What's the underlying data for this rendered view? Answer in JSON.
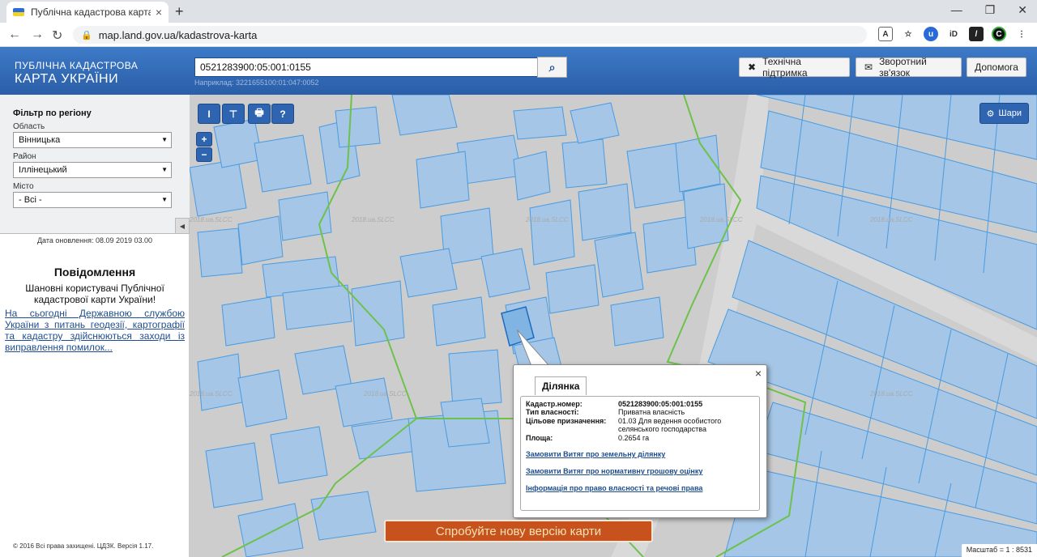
{
  "browser": {
    "tab_title": "Публічна кадастрова карта Укр",
    "url": "map.land.gov.ua/kadastrova-karta",
    "new_tab": "+",
    "tab_close": "×",
    "window_controls": [
      "—",
      "❐",
      "✕"
    ]
  },
  "header": {
    "logo_line1": "ПУБЛІЧНА КАДАСТРОВА",
    "logo_line2": "КАРТА УКРАЇНИ",
    "search_value": "0521283900:05:001:0155",
    "search_example": "Наприклад: 3221655100:01:047:0052",
    "support_label": "Технічна підтримка",
    "feedback_label": "Зворотний зв'язок",
    "help_label": "Допомога"
  },
  "sidebar": {
    "filter_title": "Фільтр по регіону",
    "oblast_label": "Область",
    "oblast_value": "Вінницька",
    "rayon_label": "Район",
    "rayon_value": "Іллінецький",
    "misto_label": "Місто",
    "misto_value": "- Всі -",
    "updated": "Дата оновлення: 08.09 2019 03.00",
    "news_title": "Повідомлення",
    "news_greeting": "Шановні користувачі Публічної кадастрової карти України!",
    "news_text": "На сьогодні Державною службою України з питань геодезії, картографії та кадастру здійснюються заходи із виправлення помилок...",
    "copyright": "© 2016 Всі права захищені. ЦДЗК. Версія 1.17."
  },
  "map": {
    "tool_measure_line": "I",
    "tool_measure_area": "⊤",
    "tool_print": "🖶",
    "tool_identify": "?",
    "zoom_in": "+",
    "zoom_out": "−",
    "layers_label": "Шари",
    "watermark": "2018.ua.SLCC",
    "new_version": "Спробуйте нову версію карти",
    "scale": "Масштаб = 1 : 8531"
  },
  "popup": {
    "tab": "Ділянка",
    "close": "×",
    "rows": [
      {
        "label": "Кадастр.номер:",
        "value": "0521283900:05:001:0155"
      },
      {
        "label": "Тип власності:",
        "value": "Приватна власність"
      },
      {
        "label": "Цільове призначення:",
        "value": "01.03 Для ведення особистого селянського господарства"
      },
      {
        "label": "Площа:",
        "value": "0.2654 га"
      }
    ],
    "link1": "Замовити Витяг про земельну ділянку",
    "link2": "Замовити Витяг про нормативну грошову оцінку",
    "link3": "Інформація про право власності та речові права"
  },
  "colors": {
    "parcel_fill": "#a5c6e6",
    "parcel_stroke": "#4a9be0",
    "boundary": "#6cc24a",
    "header": "#2f65b0",
    "new_version_btn": "#c8521d"
  }
}
